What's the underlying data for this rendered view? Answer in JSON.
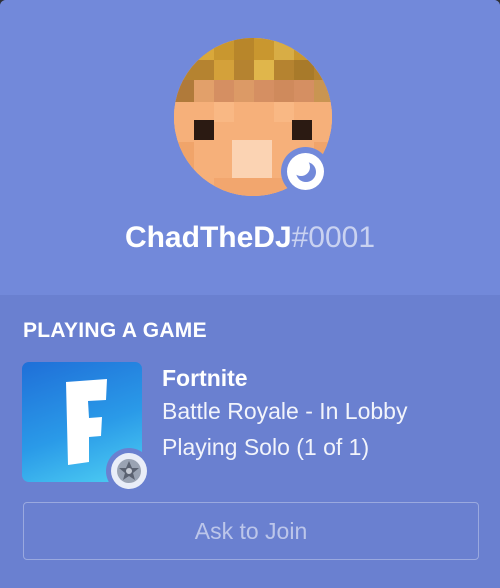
{
  "profile": {
    "username": "ChadTheDJ",
    "discriminator": "#0001",
    "status": "idle",
    "status_icon": "moon-icon",
    "avatar_icon": "pixel-avatar"
  },
  "activity": {
    "section_title": "PLAYING A GAME",
    "game_name": "Fortnite",
    "details": "Battle Royale - In Lobby",
    "state": "Playing Solo (1 of 1)",
    "game_icon": "fortnite-f-icon",
    "platform_icon": "party-emblem-icon"
  },
  "actions": {
    "join_label": "Ask to Join"
  },
  "colors": {
    "header_bg": "#7289da",
    "activity_bg": "#6a80d0",
    "text": "#ffffff"
  }
}
